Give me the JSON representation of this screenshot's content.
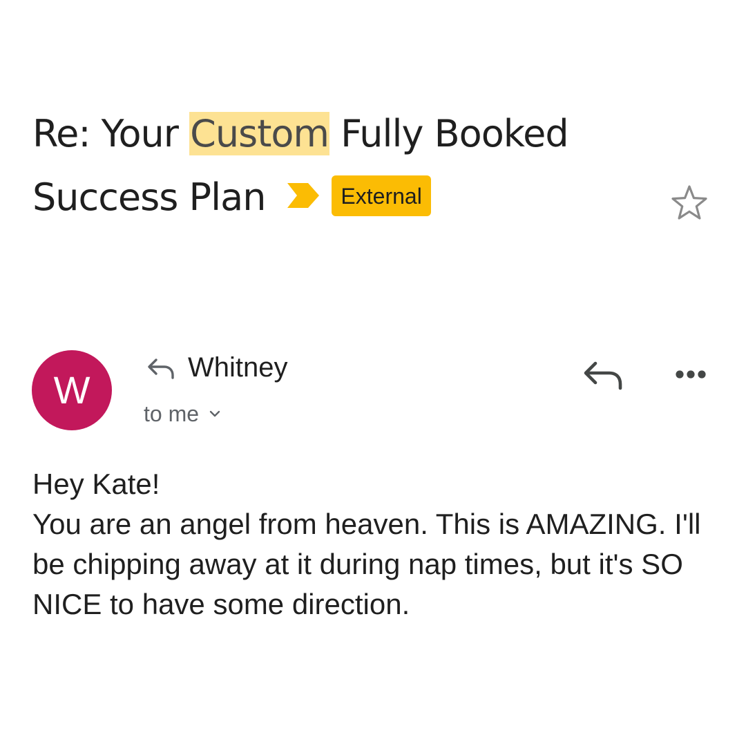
{
  "email": {
    "subject": {
      "before_highlight": "Re: Your ",
      "highlight": "Custom",
      "after_highlight": " Fully Booked",
      "line2": "Success Plan",
      "label": "External",
      "label_color": "#fbbc04",
      "highlight_color": "#fde293"
    },
    "sender": {
      "avatar_letter": "W",
      "avatar_color": "#c2185b",
      "name": "Whitney",
      "recipients": "to me"
    },
    "body": {
      "greeting": "Hey Kate!",
      "paragraph": "You are an angel from heaven. This is AMAZING. I'll be chipping away at it during nap times, but it's SO NICE to have some direction."
    },
    "icons": {
      "importance": "importance-marker-icon",
      "star": "star-icon",
      "replied": "replied-icon",
      "recipients_toggle": "chevron-down-icon",
      "reply": "reply-icon",
      "more": "more-options-icon"
    }
  }
}
